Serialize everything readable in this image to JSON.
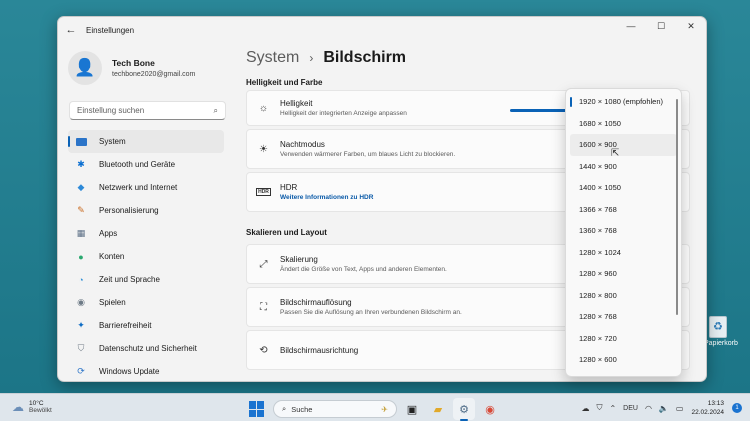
{
  "window": {
    "title": "Einstellungen",
    "back_glyph": "←",
    "min_glyph": "—",
    "max_glyph": "☐",
    "close_glyph": "✕"
  },
  "profile": {
    "name": "Tech Bone",
    "email": "techbone2020@gmail.com"
  },
  "search": {
    "placeholder": "Einstellung suchen"
  },
  "sidebar": {
    "items": [
      {
        "label": "System",
        "icon": "system-icon",
        "active": true
      },
      {
        "label": "Bluetooth und Geräte",
        "icon": "bluetooth-icon"
      },
      {
        "label": "Netzwerk und Internet",
        "icon": "wifi-icon"
      },
      {
        "label": "Personalisierung",
        "icon": "brush-icon"
      },
      {
        "label": "Apps",
        "icon": "apps-icon"
      },
      {
        "label": "Konten",
        "icon": "account-icon"
      },
      {
        "label": "Zeit und Sprache",
        "icon": "globe-clock-icon"
      },
      {
        "label": "Spielen",
        "icon": "gamepad-icon"
      },
      {
        "label": "Barrierefreiheit",
        "icon": "accessibility-icon"
      },
      {
        "label": "Datenschutz und Sicherheit",
        "icon": "shield-icon"
      },
      {
        "label": "Windows Update",
        "icon": "update-icon"
      }
    ]
  },
  "main": {
    "breadcrumb": {
      "parent": "System",
      "separator": "›",
      "current": "Bildschirm"
    },
    "section1": "Helligkeit und Farbe",
    "helligkeit": {
      "title": "Helligkeit",
      "subtitle": "Helligkeit der integrierten Anzeige anpassen"
    },
    "nachtmodus": {
      "title": "Nachtmodus",
      "subtitle": "Verwenden wärmerer Farben, um blaues Licht zu blockieren."
    },
    "hdr": {
      "title": "HDR",
      "link": "Weitere Informationen zu HDR",
      "badge": "HDR"
    },
    "section2": "Skalieren und Layout",
    "skalierung": {
      "title": "Skalierung",
      "subtitle": "Ändert die Größe von Text, Apps und anderen Elementen."
    },
    "aufloesung": {
      "title": "Bildschirmauflösung",
      "subtitle": "Passen Sie die Auflösung an Ihren verbundenen Bildschirm an."
    },
    "ausrichtung": {
      "title": "Bildschirmausrichtung"
    }
  },
  "dropdown": {
    "options": [
      "1920 × 1080 (empfohlen)",
      "1680 × 1050",
      "1600 × 900",
      "1440 × 900",
      "1400 × 1050",
      "1366 × 768",
      "1360 × 768",
      "1280 × 1024",
      "1280 × 960",
      "1280 × 800",
      "1280 × 768",
      "1280 × 720",
      "1280 × 600"
    ],
    "selected_index": 0,
    "hover_index": 2
  },
  "desktop": {
    "recycle_label": "Papierkorb"
  },
  "taskbar": {
    "weather_temp": "10°C",
    "weather_desc": "Bewölkt",
    "search_label": "Suche",
    "lang": "DEU",
    "time": "13:13",
    "date": "22.02.2024",
    "notif_count": "1"
  },
  "colors": {
    "accent": "#0a62b6",
    "desktop": "#1f7d8e",
    "window_bg": "#f3f3f3"
  }
}
